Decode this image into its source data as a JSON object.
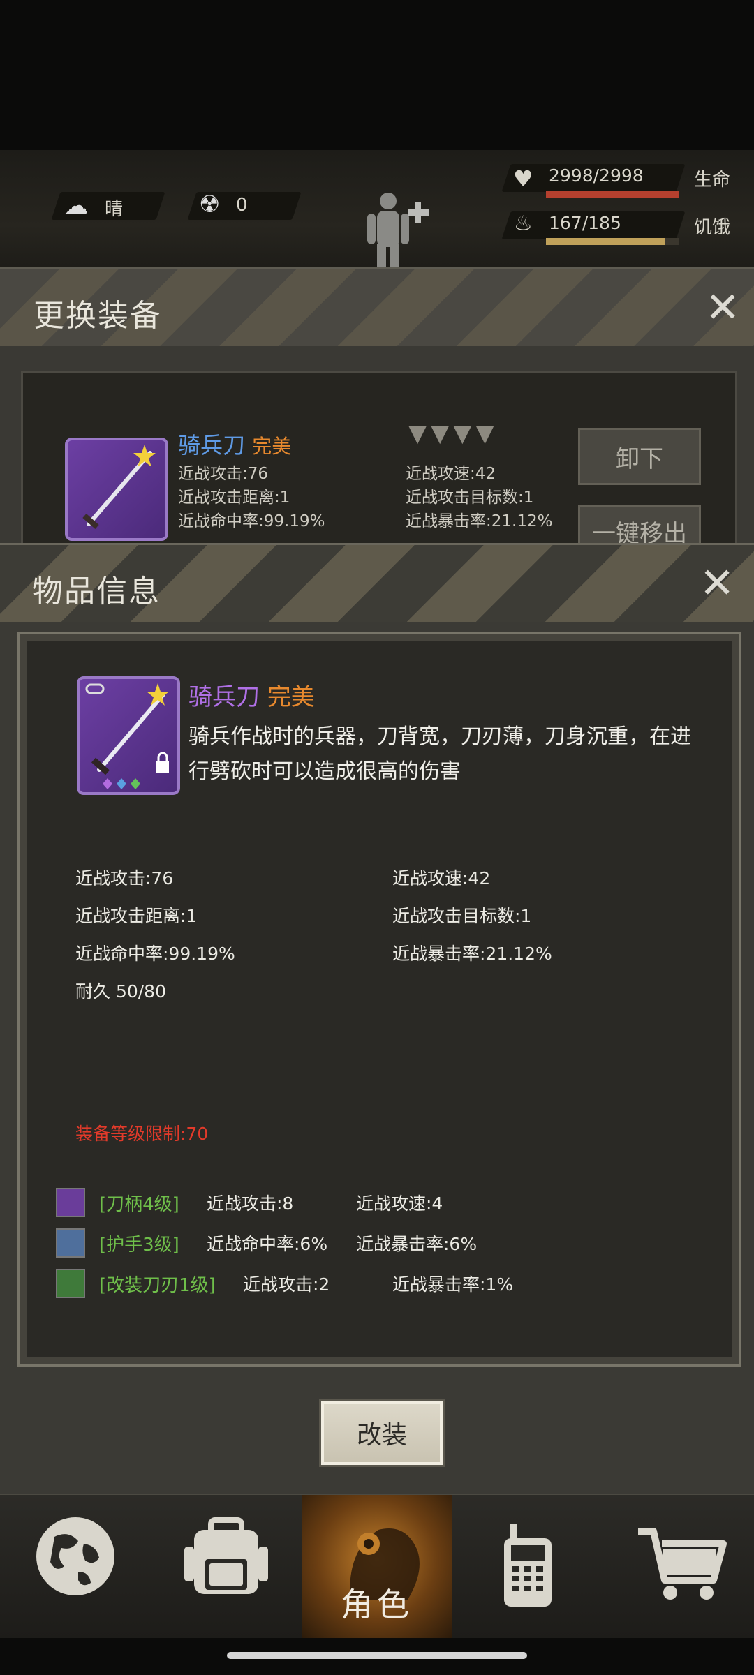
{
  "hud": {
    "weather": "晴",
    "radiation": "0",
    "health": {
      "value": "2998/2998",
      "label": "生命",
      "fraction": 1.0
    },
    "hunger": {
      "value": "167/185",
      "label": "饥饿",
      "fraction": 0.9
    }
  },
  "change_panel": {
    "title": "更换装备",
    "item_name": "骑兵刀",
    "item_quality": "完美",
    "stats": [
      "近战攻击:76",
      "近战攻速:42",
      "近战攻击距离:1",
      "近战攻击目标数:1",
      "近战命中率:99.19%",
      "近战暴击率:21.12%"
    ],
    "unequip_label": "卸下",
    "remove_label": "一键移出"
  },
  "item_info": {
    "title": "物品信息",
    "name": "骑兵刀",
    "quality": "完美",
    "description": "骑兵作战时的兵器，刀背宽，刀刃薄，刀身沉重，在进行劈砍时可以造成很高的伤害",
    "stats": {
      "melee_attack": "近战攻击:76",
      "melee_speed": "近战攻速:42",
      "melee_range": "近战攻击距离:1",
      "melee_targets": "近战攻击目标数:1",
      "melee_hit": "近战命中率:99.19%",
      "melee_crit": "近战暴击率:21.12%",
      "durability": "耐久 50/80"
    },
    "level_requirement": "装备等级限制:70",
    "mods": [
      {
        "tag": "[刀柄4级]",
        "stat1": "近战攻击:8",
        "stat2": "近战攻速:4",
        "color": "#6a3d9a"
      },
      {
        "tag": "[护手3级]",
        "stat1": "近战命中率:6%",
        "stat2": "近战暴击率:6%",
        "color": "#4f6f9c"
      },
      {
        "tag": "[改装刀刃1级]",
        "stat1": "近战攻击:2",
        "stat2": "近战暴击率:1%",
        "color": "#3f7a3a"
      }
    ],
    "modify_button": "改装"
  },
  "nav": {
    "items": [
      "world",
      "backpack",
      "角色",
      "radio",
      "shop"
    ],
    "active_label": "角色"
  },
  "colors": {
    "quality_orange": "#e7892e",
    "name_purple": "#b070e6",
    "name_blue": "#5f9be6",
    "level_red": "#e23a2a",
    "mod_green": "#6fbf4a"
  }
}
